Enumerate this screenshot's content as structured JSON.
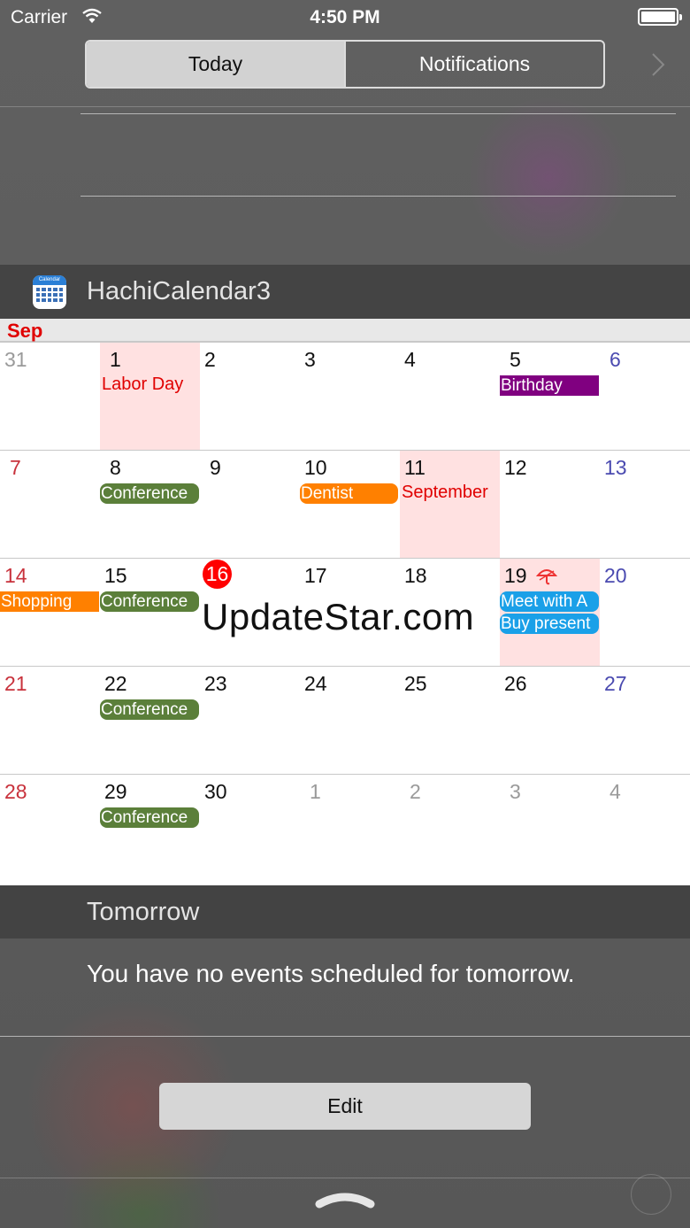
{
  "status_bar": {
    "carrier": "Carrier",
    "time": "4:50 PM"
  },
  "segmented_control": {
    "tabs": [
      "Today",
      "Notifications"
    ],
    "selected": "Today"
  },
  "widget": {
    "title": "HachiCalendar3",
    "icon_label": "Calendar"
  },
  "calendar": {
    "month": "Sep",
    "weeks": [
      [
        "31",
        "1",
        "2",
        "3",
        "4",
        "5",
        "6"
      ],
      [
        "7",
        "8",
        "9",
        "10",
        "11",
        "12",
        "13"
      ],
      [
        "14",
        "15",
        "16",
        "17",
        "18",
        "19",
        "20"
      ],
      [
        "21",
        "22",
        "23",
        "24",
        "25",
        "26",
        "27"
      ],
      [
        "28",
        "29",
        "30",
        "1",
        "2",
        "3",
        "4"
      ]
    ],
    "holidays": [
      "Labor Day",
      "September"
    ],
    "events": {
      "birthday": "Birthday",
      "conference": "Conference",
      "dentist": "Dentist",
      "shopping": "Shopping",
      "meet": "Meet with A",
      "buy_present": "Buy present"
    },
    "colors": {
      "birthday": "#800080",
      "conference": "#5b7f3a",
      "dentist": "#ff8000",
      "shopping": "#ff8000",
      "meet": "#1aa0e8",
      "holiday_bg": "#ffe1e1",
      "today": "#ff0000"
    },
    "watermark": "UpdateStar.com"
  },
  "tomorrow": {
    "title": "Tomorrow",
    "message": "You have no events scheduled for tomorrow."
  },
  "edit_button": {
    "label": "Edit"
  },
  "icons": [
    "wifi-icon",
    "battery-icon",
    "chevron-right-icon",
    "calendar-app-icon",
    "umbrella-icon",
    "grabber-icon",
    "plus-circle-icon"
  ]
}
